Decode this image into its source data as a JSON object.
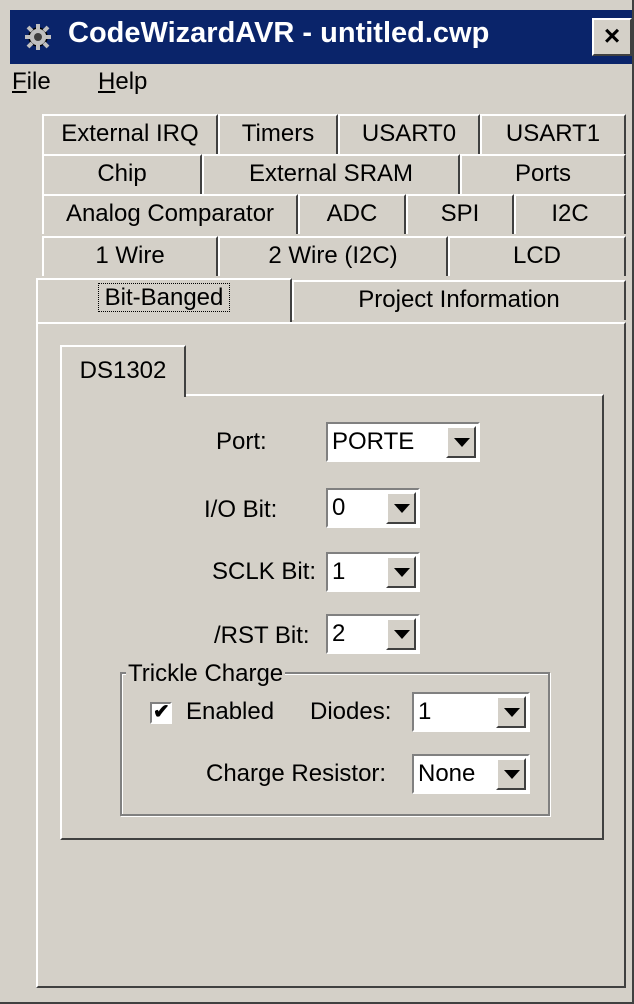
{
  "window": {
    "title": "CodeWizardAVR - untitled.cwp",
    "close_label": "×",
    "icon": "gear-icon"
  },
  "menu": {
    "file": {
      "mnemonic": "F",
      "rest": "ile"
    },
    "help": {
      "mnemonic": "H",
      "rest": "elp"
    }
  },
  "tabs": {
    "row1": [
      "External IRQ",
      "Timers",
      "USART0",
      "USART1"
    ],
    "row2": [
      "Chip",
      "External SRAM",
      "Ports"
    ],
    "row3": [
      "Analog Comparator",
      "ADC",
      "SPI",
      "I2C"
    ],
    "row4": [
      "1 Wire",
      "2 Wire (I2C)",
      "LCD"
    ],
    "row5": [
      "Bit-Banged",
      "Project Information"
    ],
    "active": "Bit-Banged"
  },
  "ds1302": {
    "tab_label": "DS1302",
    "port": {
      "label": "Port:",
      "value": "PORTE"
    },
    "io_bit": {
      "label": "I/O Bit:",
      "value": "0"
    },
    "sclk_bit": {
      "label": "SCLK Bit:",
      "value": "1"
    },
    "rst_bit": {
      "label": "/RST Bit:",
      "value": "2"
    },
    "trickle": {
      "group_label": "Trickle Charge",
      "enabled_label": "Enabled",
      "enabled_checked": true,
      "check_glyph": "✔",
      "diodes_label": "Diodes:",
      "diodes_value": "1",
      "resistor_label": "Charge Resistor:",
      "resistor_value": "None"
    }
  }
}
